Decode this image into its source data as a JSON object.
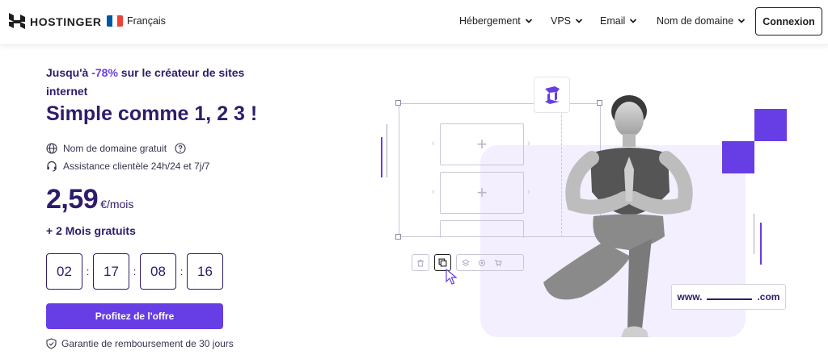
{
  "brand": {
    "name": "HOSTINGER",
    "logo_icon": "hostinger-logo-icon"
  },
  "language": {
    "label": "Français",
    "flag_colors": [
      "#0055a4",
      "#ffffff",
      "#ef4135"
    ]
  },
  "nav": {
    "items": [
      {
        "label": "Hébergement",
        "icon": "chevron-down-icon"
      },
      {
        "label": "VPS",
        "icon": "chevron-down-icon"
      },
      {
        "label": "Email",
        "icon": "chevron-down-icon"
      },
      {
        "label": "Nom de domaine",
        "icon": "chevron-down-icon"
      }
    ],
    "login_label": "Connexion"
  },
  "hero": {
    "promo_prefix": "Jusqu'à ",
    "promo_pct": "-78%",
    "promo_suffix": " sur le créateur de sites internet",
    "title": "Simple comme 1, 2 3 !",
    "features": [
      {
        "label": "Nom de domaine gratuit",
        "icon": "globe-icon",
        "extra_icon": "question-circle-icon"
      },
      {
        "label": "Assistance clientèle 24h/24 et 7j/7",
        "icon": "headset-icon"
      }
    ],
    "price_value": "2,59",
    "price_unit": "€/mois",
    "bonus": "+ 2 Mois gratuits",
    "countdown": [
      "02",
      "17",
      "08",
      "16"
    ],
    "countdown_separator": ":",
    "cta_label": "Profitez de l'offre",
    "guarantee": "Garantie de remboursement de 30 jours",
    "guarantee_icon": "shield-check-icon"
  },
  "illustration": {
    "domain_prefix": "www.",
    "domain_suffix": ".com",
    "accent": "#673de6"
  }
}
